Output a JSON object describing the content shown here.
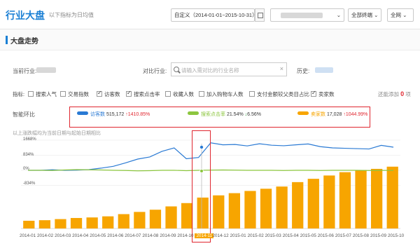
{
  "header": {
    "title": "行业大盘",
    "subtitle": "以下指标为日均值",
    "date_range": "自定义（2014-01-01~2015-10-31）",
    "terminal_select": "全部终端 ⌄",
    "network_select": "全网 ⌄"
  },
  "section": {
    "title": "大盘走势"
  },
  "filters": {
    "current_industry_label": "当前行业:",
    "compare_industry_label": "对比行业:",
    "search_placeholder": "请输入需对比的行业名称",
    "clear": "×",
    "history_label": "历史:"
  },
  "indicators": {
    "label": "指标:",
    "items": [
      {
        "label": "搜索人气",
        "checked": false
      },
      {
        "label": "交易指数",
        "checked": false
      },
      {
        "label": "访客数",
        "checked": true
      },
      {
        "label": "搜索点击率",
        "checked": true
      },
      {
        "label": "收藏人数",
        "checked": false
      },
      {
        "label": "加入购物车人数",
        "checked": false
      },
      {
        "label": "支付金额较父类目占比",
        "checked": false
      },
      {
        "label": "卖家数",
        "checked": true
      }
    ],
    "can_add_text": "还能添加",
    "can_add_count": "0",
    "can_add_unit": "项"
  },
  "compare": {
    "label": "智能环比",
    "items": [
      {
        "name": "访客数",
        "value": "515,172",
        "arrow": "↑",
        "change": "1410.85%",
        "color": "#2a7ad4",
        "trend": "up"
      },
      {
        "name": "搜索点击率",
        "value": "21.54%",
        "arrow": "↓",
        "change": "6.56%",
        "color": "#8cc63f",
        "trend": "down"
      },
      {
        "name": "卖家数",
        "value": "17,028",
        "arrow": "↑",
        "change": "1044.99%",
        "color": "#f7a500",
        "trend": "up"
      }
    ]
  },
  "chart_note": "以上涨跌幅均为当前日期与起始日期相比",
  "chart_data": {
    "type": "line",
    "y_ticks": [
      "1668%",
      "834%",
      "0%",
      "-834%"
    ],
    "x_ticks": [
      "2014-01",
      "2014-02",
      "2014-03",
      "2014-04",
      "2014-05",
      "2014-06",
      "2014-07",
      "2014-08",
      "2014-09",
      "2014-10",
      "2014-11",
      "2014-12",
      "2015-01",
      "2015-02",
      "2015-03",
      "2015-04",
      "2015-05",
      "2015-06",
      "2015-07",
      "2015-08",
      "2015-09",
      "2015-10"
    ],
    "highlighted_tick": "2014-11",
    "series": [
      {
        "name": "访客数",
        "color": "#2a7ad4",
        "kind": "line",
        "values": [
          0,
          0,
          30,
          0,
          10,
          40,
          120,
          220,
          410,
          620,
          740,
          1050,
          1240,
          640,
          710,
          1520,
          1410,
          1430,
          1350,
          1470,
          1390,
          1360,
          1410,
          1460,
          1310,
          1240,
          1220,
          1200,
          1180,
          1380,
          1280
        ]
      },
      {
        "name": "搜索点击率",
        "color": "#8cc63f",
        "kind": "line",
        "values": [
          0,
          0,
          -10,
          20,
          40,
          30,
          20,
          0,
          -10,
          -30,
          -20,
          0,
          0,
          -20,
          0,
          10,
          20,
          10,
          0,
          0,
          0,
          -10,
          0,
          0,
          -10,
          0,
          0,
          0,
          -10,
          -5,
          -5
        ]
      },
      {
        "name": "卖家数",
        "color": "#f7a500",
        "kind": "bar",
        "values": [
          70,
          75,
          85,
          95,
          100,
          110,
          130,
          150,
          170,
          200,
          230,
          280,
          300,
          320,
          340,
          360,
          380,
          420,
          450,
          480,
          510,
          530,
          540,
          560
        ]
      }
    ],
    "ylim": [
      -1668,
      1668
    ],
    "grid": true
  }
}
